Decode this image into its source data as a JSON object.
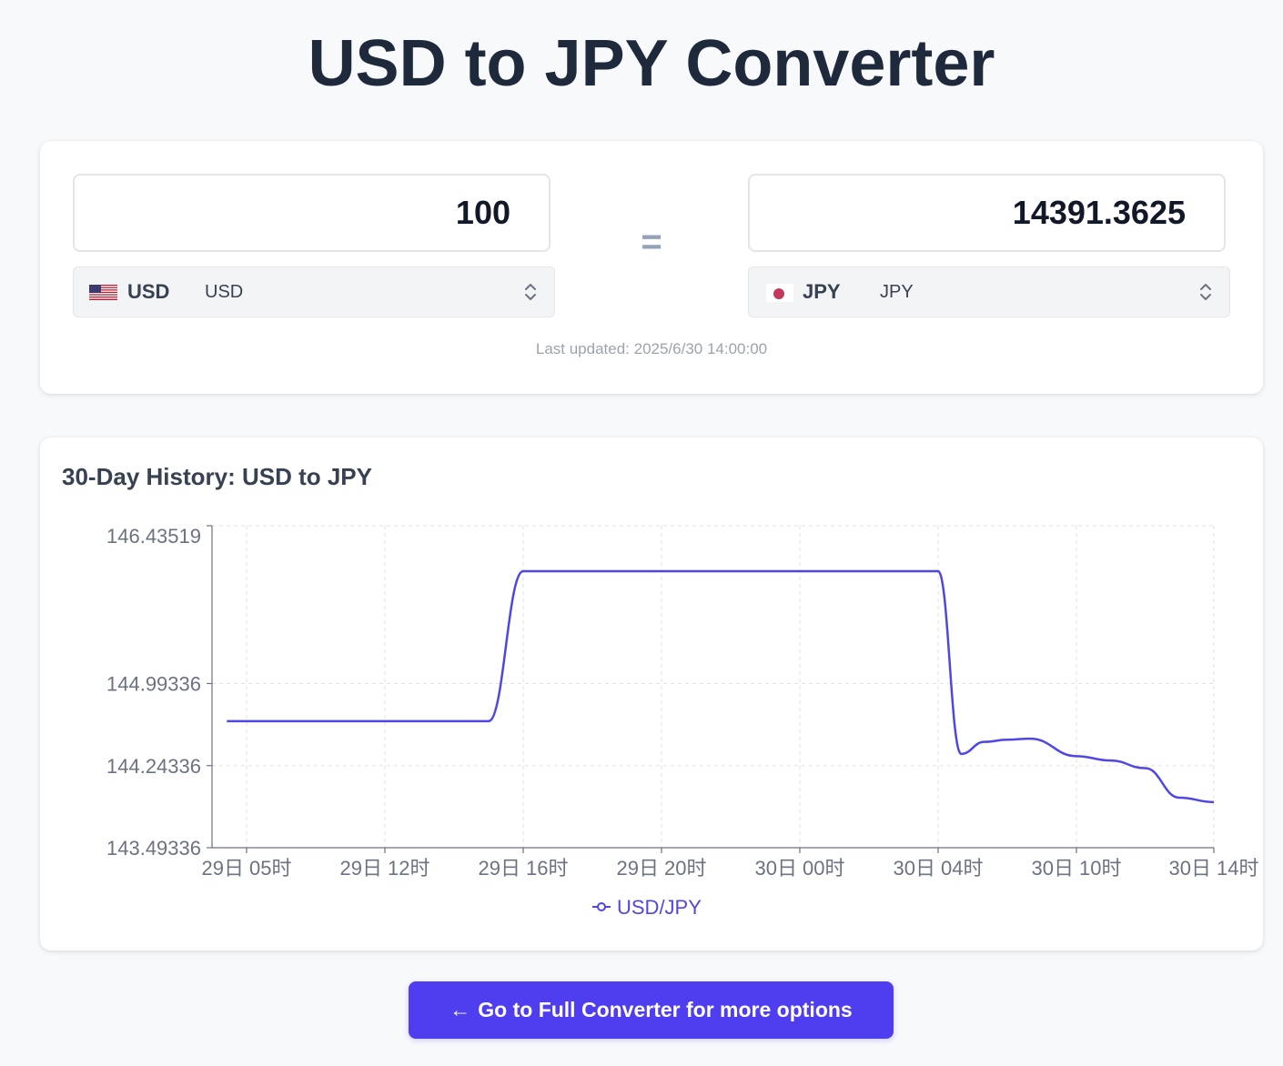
{
  "page": {
    "title": "USD to JPY Converter"
  },
  "converter": {
    "from": {
      "amount": "100",
      "code": "USD",
      "name": "USD",
      "flag_icon": "us-flag-icon"
    },
    "equals_sign": "=",
    "to": {
      "amount": "14391.3625",
      "code": "JPY",
      "name": "JPY",
      "flag_icon": "jp-flag-icon"
    },
    "last_updated": "Last updated: 2025/6/30 14:00:00"
  },
  "history": {
    "title": "30-Day History: USD to JPY"
  },
  "chart_data": {
    "type": "line",
    "title": "30-Day History: USD to JPY",
    "xlabel": "",
    "ylabel": "",
    "x_ticks": [
      "29日 05时",
      "29日 12时",
      "29日 16时",
      "29日 20时",
      "30日 00时",
      "30日 04时",
      "30日 10时",
      "30日 14时"
    ],
    "y_ticks": [
      "146.43519",
      "144.99336",
      "144.24336",
      "143.49336"
    ],
    "ylim": [
      143.49336,
      146.43519
    ],
    "grid": true,
    "legend_position": "bottom",
    "series": [
      {
        "name": "USD/JPY",
        "color": "#4f46e5",
        "points": [
          {
            "x": "29日 04时",
            "y": 144.65
          },
          {
            "x": "29日 05时",
            "y": 144.65
          },
          {
            "x": "29日 12时",
            "y": 144.65
          },
          {
            "x": "29日 15时",
            "y": 144.65
          },
          {
            "x": "29日 16时",
            "y": 146.02
          },
          {
            "x": "29日 20时",
            "y": 146.02
          },
          {
            "x": "30日 00时",
            "y": 146.02
          },
          {
            "x": "30日 04时",
            "y": 146.02
          },
          {
            "x": "30日 05时",
            "y": 144.35
          },
          {
            "x": "30日 06时",
            "y": 144.46
          },
          {
            "x": "30日 07时",
            "y": 144.48
          },
          {
            "x": "30日 08时",
            "y": 144.49
          },
          {
            "x": "30日 10时",
            "y": 144.33
          },
          {
            "x": "30日 11时",
            "y": 144.29
          },
          {
            "x": "30日 12时",
            "y": 144.22
          },
          {
            "x": "30日 13时",
            "y": 143.95
          },
          {
            "x": "30日 14时",
            "y": 143.91
          }
        ]
      }
    ]
  },
  "cta": {
    "label": "Go to Full Converter for more options",
    "arrow": "←"
  }
}
